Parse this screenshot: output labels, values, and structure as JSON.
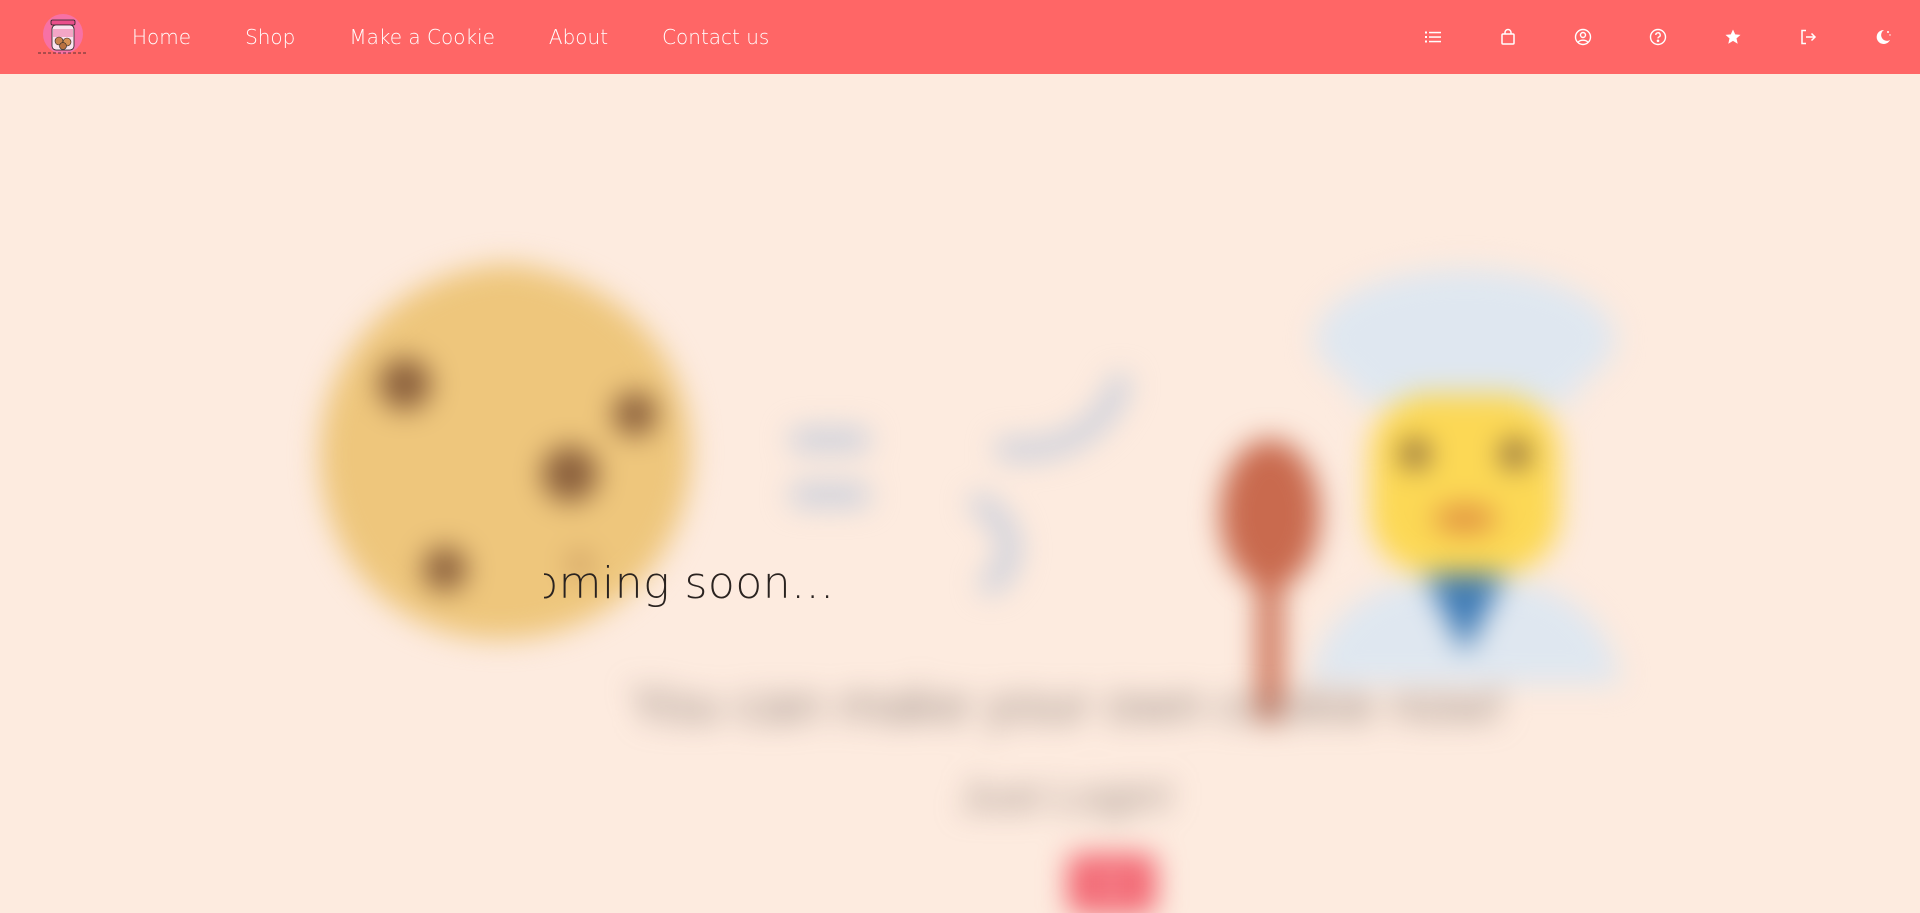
{
  "nav": {
    "logo_alt": "Cookie jar logo",
    "links": [
      {
        "label": "Home"
      },
      {
        "label": "Shop"
      },
      {
        "label": "Make a Cookie"
      },
      {
        "label": "About"
      },
      {
        "label": "Contact us"
      }
    ],
    "icons": [
      "list-icon",
      "shopping-bag-icon",
      "user-circle-icon",
      "help-circle-icon",
      "star-icon",
      "logout-icon",
      "theme-toggle-icon"
    ]
  },
  "hero": {
    "coming_soon": "Coming soon...",
    "tagline": "You can make your own cookie now!",
    "login_prompt": "Just Login!",
    "button_label": "Go"
  },
  "colors": {
    "navbar": "#ff6666",
    "background": "#fdebdf",
    "accent": "#f26470"
  }
}
